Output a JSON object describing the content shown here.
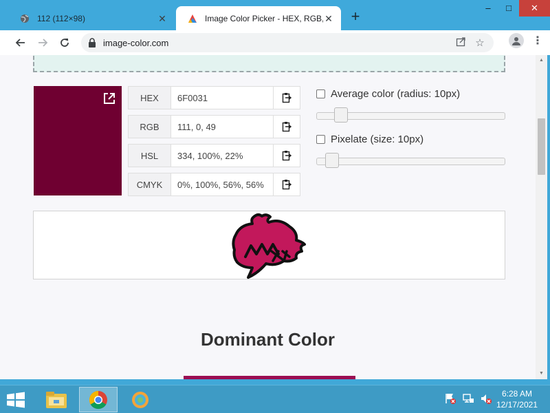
{
  "browser": {
    "tabs": [
      {
        "title": "112 (112×98)",
        "active": false
      },
      {
        "title": "Image Color Picker - HEX, RGB, H",
        "active": true
      }
    ],
    "url": "image-color.com",
    "new_tab_symbol": "+",
    "window_buttons": {
      "minimize": "–",
      "maximize": "□",
      "close": "✕"
    }
  },
  "picker": {
    "swatch_color": "#6F0031",
    "rows": [
      {
        "label": "HEX",
        "value": "6F0031"
      },
      {
        "label": "RGB",
        "value": "111, 0, 49"
      },
      {
        "label": "HSL",
        "value": "334, 100%, 22%"
      },
      {
        "label": "CMYK",
        "value": "0%, 100%, 56%, 56%"
      }
    ],
    "options": {
      "average_label": "Average color (radius: 10px)",
      "average_level": 0.1,
      "pixelate_label": "Pixelate (size: 10px)",
      "pixelate_level": 0.05
    }
  },
  "section": {
    "dominant_title": "Dominant Color",
    "dominant_color": "#9B0E52"
  },
  "taskbar": {
    "time": "6:28 AM",
    "date": "12/17/2021"
  },
  "colors": {
    "titlebar": "#3FA9DB",
    "taskbar": "#3E9BC5",
    "accent": "#6F0031",
    "image_fill": "#C2185B"
  },
  "icons": [
    "globe-icon",
    "favicon-icon",
    "close-icon",
    "back-icon",
    "forward-icon",
    "reload-icon",
    "lock-icon",
    "share-icon",
    "star-icon",
    "profile-icon",
    "menu-icon",
    "external-link-icon",
    "clipboard-icon",
    "windows-start-icon",
    "file-explorer-icon",
    "chrome-icon",
    "app-icon",
    "flag-icon",
    "network-icon",
    "volume-icon"
  ]
}
